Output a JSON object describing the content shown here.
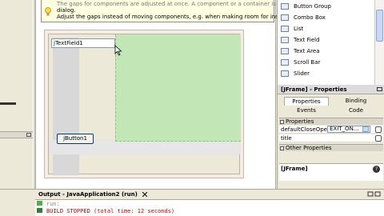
{
  "designer": {
    "hint_line1": "The gaps for components are adjusted at once. A component or a container is",
    "hint_line2": "dialog.",
    "hint_line3": "Adjust the gaps instead of moving components, e.g. when making room for inserting",
    "textfield_label": "jTextField1",
    "button_label": "jButton1"
  },
  "palette": {
    "items": [
      {
        "label": "Button Group",
        "icon": "button-group-icon"
      },
      {
        "label": "Combo Box",
        "icon": "combo-box-icon"
      },
      {
        "label": "List",
        "icon": "list-icon"
      },
      {
        "label": "Text Field",
        "icon": "text-field-icon"
      },
      {
        "label": "Text Area",
        "icon": "text-area-icon"
      },
      {
        "label": "Scroll Bar",
        "icon": "scroll-bar-icon"
      },
      {
        "label": "Slider",
        "icon": "slider-icon"
      }
    ]
  },
  "properties": {
    "title": "[JFrame] - Properties",
    "tabs": {
      "properties": "Properties",
      "binding": "Binding",
      "events": "Events",
      "code": "Code"
    },
    "group1": "Properties",
    "row1_name": "defaultCloseOper",
    "row1_value": "EXIT_ON...",
    "row2_name": "title",
    "group2": "Other Properties",
    "footer": "[JFrame]"
  },
  "output": {
    "tab_label": "Output - JavaApplication2 (run)",
    "line1": "run:",
    "line2": "BUILD STOPPED (total time: 12 seconds)"
  },
  "colors": {
    "green_area": "#c2e6b6",
    "hint_bg": "#ffffe1",
    "stopped_text": "#c00000"
  }
}
